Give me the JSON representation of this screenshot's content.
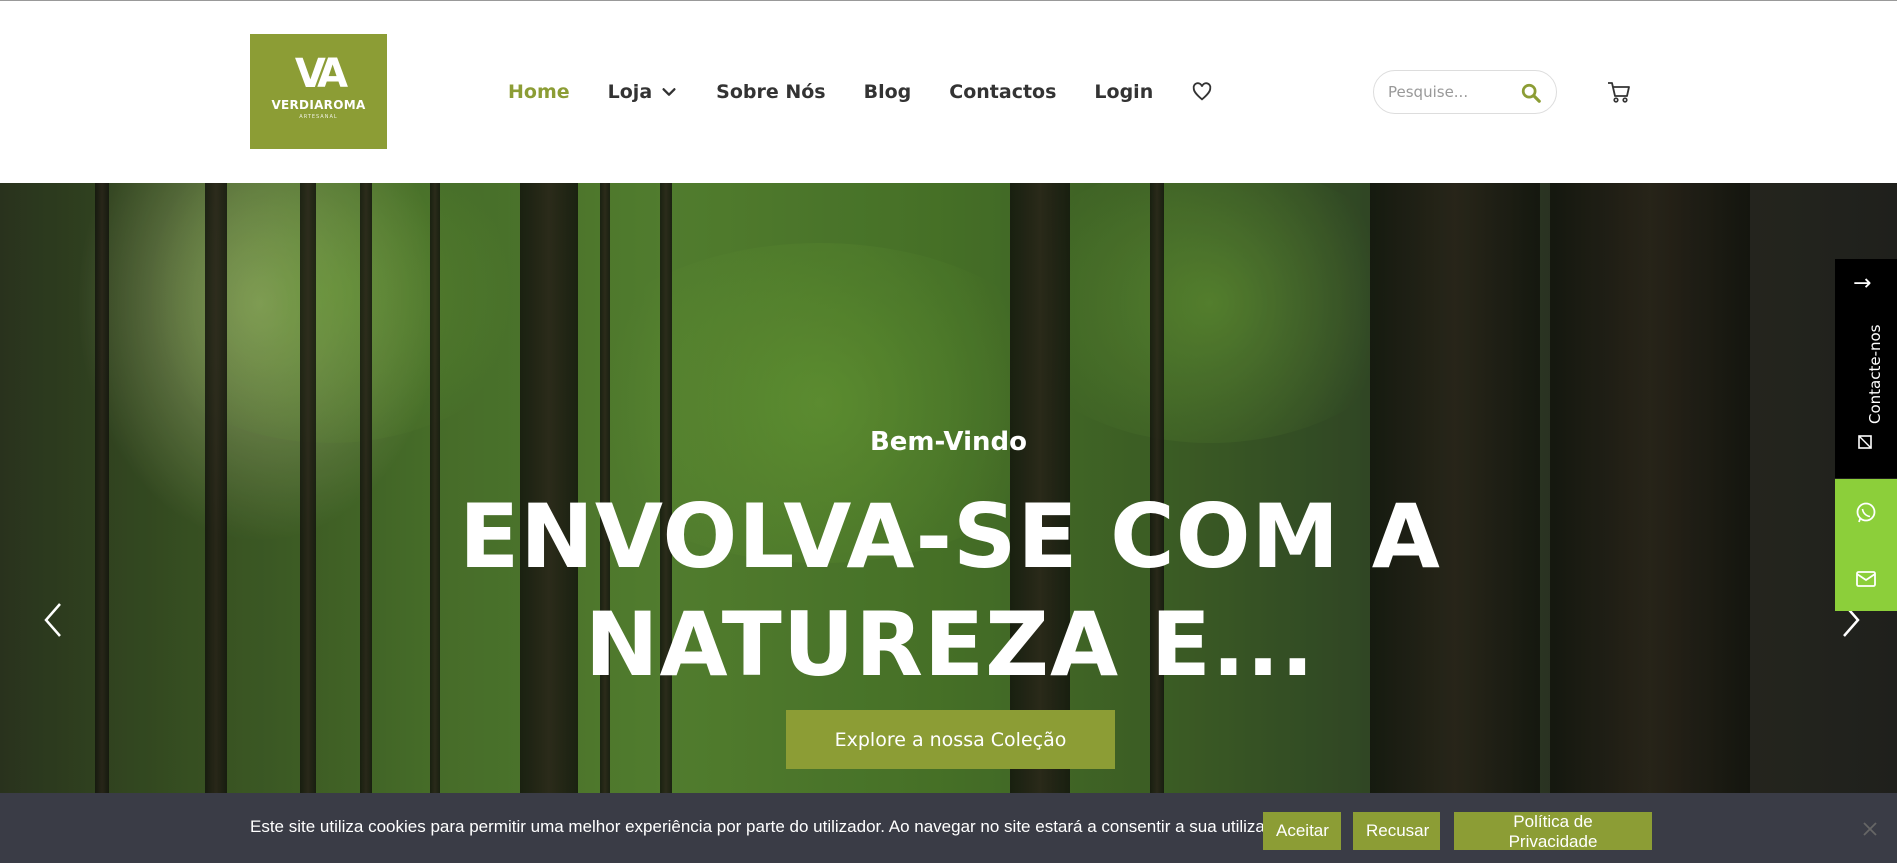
{
  "brand": {
    "mark": "VA",
    "name": "VERDIAROMA",
    "sub": "ARTESANAL",
    "accent": "#8c9d35"
  },
  "nav": {
    "items": [
      {
        "label": "Home",
        "active": true
      },
      {
        "label": "Loja",
        "has_dropdown": true
      },
      {
        "label": "Sobre Nós"
      },
      {
        "label": "Blog"
      },
      {
        "label": "Contactos"
      },
      {
        "label": "Login"
      }
    ],
    "wishlist_icon": "heart-icon"
  },
  "search": {
    "placeholder": "Pesquise...",
    "icon": "search-icon"
  },
  "cart_icon": "cart-icon",
  "hero": {
    "subtitle": "Bem-Vindo",
    "title": "ENVOLVA-SE COM A NATUREZA E...",
    "button_label": "Explore a nossa Coleção",
    "prev_icon": "chevron-left-icon",
    "next_icon": "chevron-right-icon"
  },
  "side_contact": {
    "label": "Contacte-nos",
    "arrow": "→",
    "whatsapp_icon": "whatsapp-icon",
    "email_icon": "envelope-icon",
    "green": "#8ccf3a"
  },
  "cookie": {
    "text": "Este site utiliza cookies para permitir uma melhor experiência por parte do utilizador. Ao navegar no site estará a consentir a sua utilização.",
    "accept_label": "Aceitar",
    "reject_label": "Recusar",
    "privacy_label": "Política de Privacidade",
    "background": "#3a3c46"
  }
}
